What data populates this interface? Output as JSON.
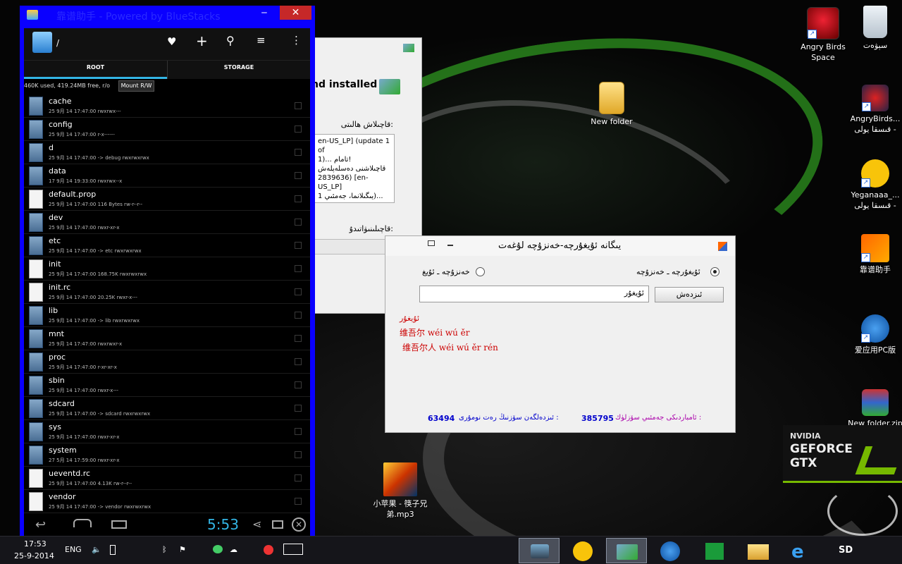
{
  "desktop_icons": [
    {
      "label": "Angry Birds Space",
      "icon": "angry-birds-space-icon"
    },
    {
      "label": "سېۋەت",
      "icon": "recycle-bin-icon"
    },
    {
      "label": "New folder",
      "icon": "folder-icon"
    },
    {
      "label": "AngryBirds... قىسقا يولى -",
      "icon": "angry-birds-star-wars-icon"
    },
    {
      "label": "Yeganaaa_... قىسقا يولى -",
      "icon": "yeganaaa-icon"
    },
    {
      "label": "靠谱助手",
      "icon": "kaopu-icon"
    },
    {
      "label": "爱应用PC版",
      "icon": "owl-icon"
    },
    {
      "label": "New folder.zip",
      "icon": "winrar-icon"
    },
    {
      "label": "小苹果 - 筷子兄弟.mp3",
      "icon": "mp3-icon"
    }
  ],
  "geforce": {
    "brand": "NVIDIA",
    "line1": "GEFORCE",
    "line2": "GTX"
  },
  "bluestacks": {
    "title": "靠谱助手 - Powered by BlueStacks",
    "path": "/",
    "tabs": [
      "ROOT",
      "STORAGE"
    ],
    "usage": "460K used, 419.24MB free, r/o",
    "mount_button": "Mount R/W",
    "files": [
      {
        "name": "cache",
        "meta": "25 9月 14 17:47:00   rwxrwx---",
        "type": "folder"
      },
      {
        "name": "config",
        "meta": "25 9月 14 17:47:00   r-x------",
        "type": "folder"
      },
      {
        "name": "d",
        "meta": "25 9月 14 17:47:00  -> debug  rwxrwxrwx",
        "type": "folder"
      },
      {
        "name": "data",
        "meta": "17 9月 14 19:33:00   rwxrwx--x",
        "type": "folder"
      },
      {
        "name": "default.prop",
        "meta": "25 9月 14 17:47:00  116 Bytes  rw-r--r--",
        "type": "doc"
      },
      {
        "name": "dev",
        "meta": "25 9月 14 17:47:00   rwxr-xr-x",
        "type": "folder"
      },
      {
        "name": "etc",
        "meta": "25 9月 14 17:47:00  -> etc  rwxrwxrwx",
        "type": "folder"
      },
      {
        "name": "init",
        "meta": "25 9月 14 17:47:00  168.75K  rwxrwxrwx",
        "type": "doc"
      },
      {
        "name": "init.rc",
        "meta": "25 9月 14 17:47:00  20.25K  rwxr-x---",
        "type": "doc"
      },
      {
        "name": "lib",
        "meta": "25 9月 14 17:47:00  -> lib  rwxrwxrwx",
        "type": "folder"
      },
      {
        "name": "mnt",
        "meta": "25 9月 14 17:47:00   rwxrwxr-x",
        "type": "folder"
      },
      {
        "name": "proc",
        "meta": "25 9月 14 17:47:00   r-xr-xr-x",
        "type": "folder"
      },
      {
        "name": "sbin",
        "meta": "25 9月 14 17:47:00   rwxr-x---",
        "type": "folder"
      },
      {
        "name": "sdcard",
        "meta": "25 9月 14 17:47:00  -> sdcard  rwxrwxrwx",
        "type": "folder"
      },
      {
        "name": "sys",
        "meta": "25 9月 14 17:47:00   rwxr-xr-x",
        "type": "folder"
      },
      {
        "name": "system",
        "meta": "27 5月 14 17:59:00   rwxr-xr-x",
        "type": "folder"
      },
      {
        "name": "ueventd.rc",
        "meta": "25 9月 14 17:47:00  4.13K  rw-r--r--",
        "type": "doc"
      },
      {
        "name": "vendor",
        "meta": "25 9月 14 17:47:00  -> vendor  rwxrwxrwx",
        "type": "doc"
      }
    ],
    "clock": "5:53"
  },
  "installer": {
    "heading": "nd installed",
    "status_label": "قاچىلاش ھالىتى:",
    "log": [
      "en-US_LP] (update 1 of",
      "1)... تامام!",
      "قاچىلاشنى دەسلەپلەش",
      "2839636) [en-US_LP]",
      "يىگىلانما، جەمئىي 1)..."
    ],
    "installed_label": "قاچىلىنىۋاتىدۇ:"
  },
  "dict": {
    "title": "يىگانە ئۇيغۇرچە-خەنزۇچە لۇغەت",
    "options": [
      "ئۇيغۇرچە ـ خەنزۇچە",
      "خەنزۇچە ـ ئۇيغ"
    ],
    "search_button": "ئىزدەش",
    "search_value": "ئۇيغۇر",
    "result_head": "ئۇيغۇر",
    "results": [
      "维吾尔  wéi wú ěr",
      "维吾尔人  wéi wú ěr rén"
    ],
    "stats_label1": "ئامباردىكى جەمئىي سۆزلۈك :",
    "stats_value1": "385795",
    "stats_label2": "ئىزدەلگەن سۆزنىڭ رەت نومۇرى :",
    "stats_value2": "63494"
  },
  "taskbar": {
    "time": "17:53",
    "date": "25-9-2014",
    "lang": "ENG",
    "sd": "SD"
  }
}
